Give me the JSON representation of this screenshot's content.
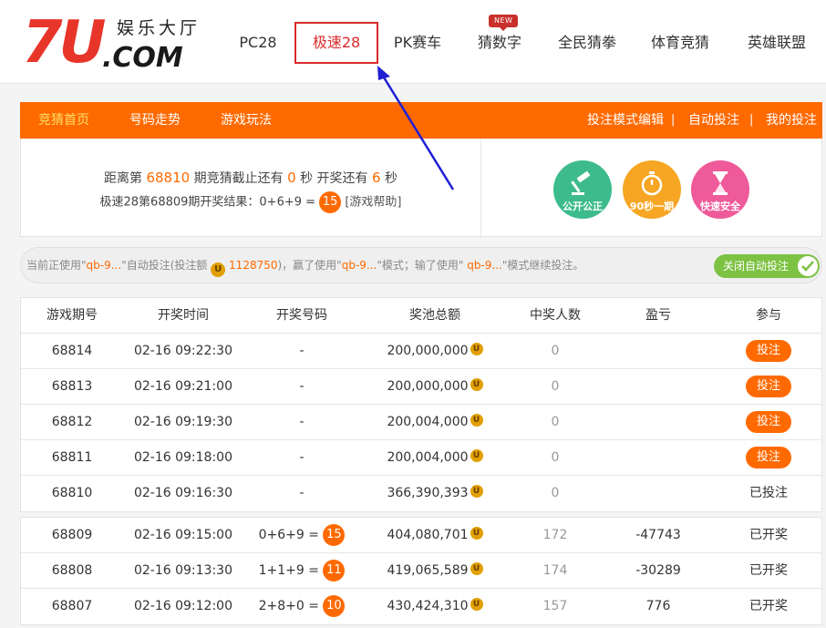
{
  "logo": {
    "main": "7U",
    "domain": ".COM",
    "tagline": "娱乐大厅"
  },
  "nav": {
    "items": [
      {
        "label": "PC28"
      },
      {
        "label": "极速28",
        "active": true
      },
      {
        "label": "PK赛车"
      },
      {
        "label": "猜数字",
        "badge": "NEW"
      },
      {
        "label": "全民猜拳"
      },
      {
        "label": "体育竞猜"
      },
      {
        "label": "英雄联盟"
      }
    ]
  },
  "subnav": {
    "left": [
      "竞猜首页",
      "号码走势",
      "游戏玩法"
    ],
    "right": [
      "投注模式编辑",
      "自动投注",
      "我的投注"
    ],
    "separator": "|"
  },
  "info": {
    "countdown": {
      "prefix": "距离第",
      "issue": "68810",
      "mid1": "期竞猜截止还有",
      "close_seconds": "0",
      "mid2": "秒 开奖还有",
      "draw_seconds": "6",
      "suffix": "秒"
    },
    "result": {
      "text": "极速28第68809期开奖结果：0+6+9 =",
      "value": "15",
      "help": "[游戏帮助]"
    },
    "badges": [
      {
        "label": "公开公正",
        "color": "#3dbb8c",
        "icon": "gavel-icon"
      },
      {
        "label": "90秒一期",
        "color": "#f6a623",
        "icon": "stopwatch-icon"
      },
      {
        "label": "快速安全",
        "color": "#ee5a9a",
        "icon": "hourglass-icon"
      }
    ]
  },
  "auto": {
    "t1": "当前正使用\"",
    "mode1": "qb-9...",
    "t2": "\"自动投注(投注额",
    "amount": "1128750",
    "t3": ")，赢了使用\"",
    "mode2": "qb-9...",
    "t4": "\"模式；输了使用\"",
    "mode3": " qb-9...",
    "t5": "\"模式继续投注。",
    "toggle_label": "关闭自动投注",
    "coin_glyph": "U"
  },
  "table": {
    "headers": [
      "游戏期号",
      "开奖时间",
      "开奖号码",
      "奖池总额",
      "中奖人数",
      "盈亏",
      "参与"
    ],
    "upcoming": [
      {
        "issue": "68814",
        "time": "02-16 09:22:30",
        "numbers": "-",
        "pool": "200,000,000",
        "winners": "0",
        "profit": "",
        "action": "投注",
        "action_type": "button"
      },
      {
        "issue": "68813",
        "time": "02-16 09:21:00",
        "numbers": "-",
        "pool": "200,000,000",
        "winners": "0",
        "profit": "",
        "action": "投注",
        "action_type": "button"
      },
      {
        "issue": "68812",
        "time": "02-16 09:19:30",
        "numbers": "-",
        "pool": "200,004,000",
        "winners": "0",
        "profit": "",
        "action": "投注",
        "action_type": "button"
      },
      {
        "issue": "68811",
        "time": "02-16 09:18:00",
        "numbers": "-",
        "pool": "200,004,000",
        "winners": "0",
        "profit": "",
        "action": "投注",
        "action_type": "button"
      },
      {
        "issue": "68810",
        "time": "02-16 09:16:30",
        "numbers": "-",
        "pool": "366,390,393",
        "winners": "0",
        "profit": "",
        "action": "已投注",
        "action_type": "done"
      }
    ],
    "finished": [
      {
        "issue": "68809",
        "time": "02-16 09:15:00",
        "numbers": "0+6+9 =",
        "sum": "15",
        "pool": "404,080,701",
        "winners": "172",
        "profit": "-47743",
        "profit_type": "pos",
        "action": "已开奖"
      },
      {
        "issue": "68808",
        "time": "02-16 09:13:30",
        "numbers": "1+1+9 =",
        "sum": "11",
        "pool": "419,065,589",
        "winners": "174",
        "profit": "-30289",
        "profit_type": "pos",
        "action": "已开奖"
      },
      {
        "issue": "68807",
        "time": "02-16 09:12:00",
        "numbers": "2+8+0 =",
        "sum": "10",
        "pool": "430,424,310",
        "winners": "157",
        "profit": "776",
        "profit_type": "neg",
        "action": "已开奖"
      }
    ]
  },
  "colors": {
    "accent": "#ff6a00",
    "highlight": "#d92b2b",
    "green": "#3aa63a",
    "arrow": "#1f1fd6"
  }
}
